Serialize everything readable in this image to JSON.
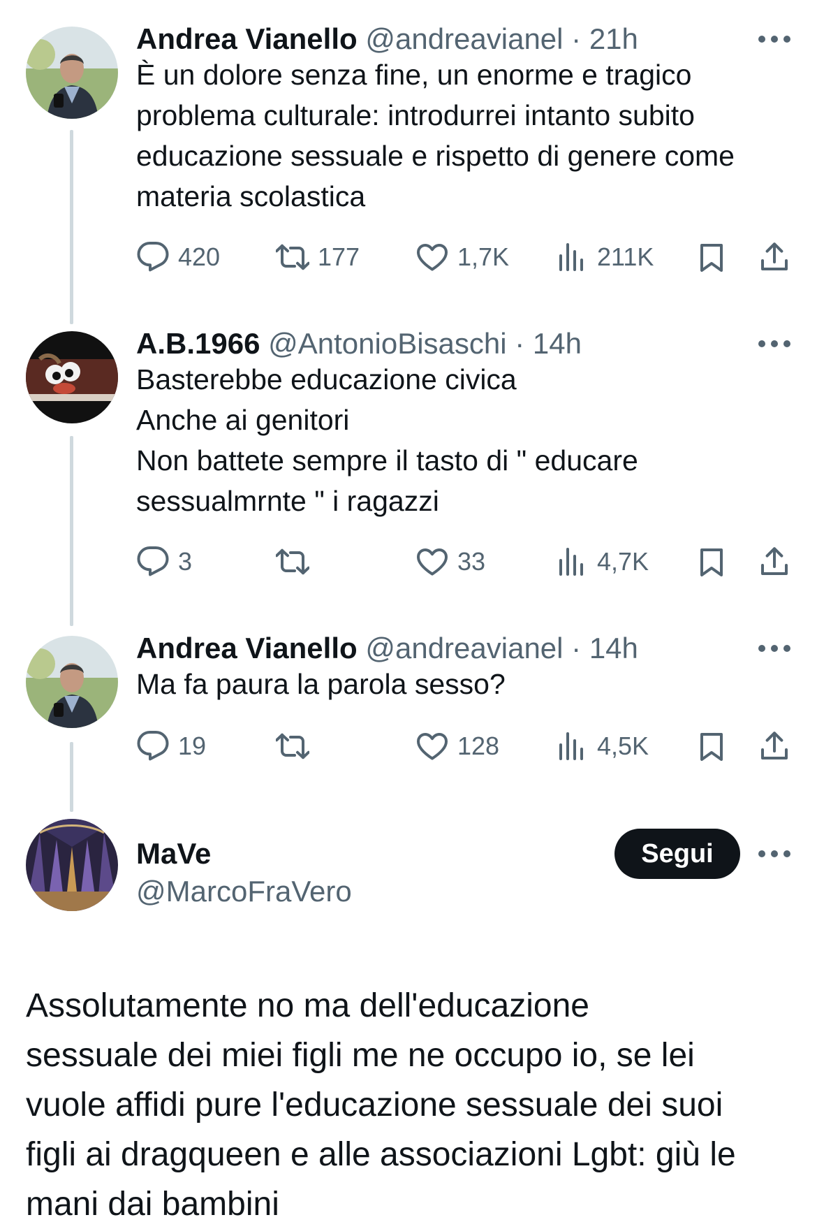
{
  "tweets": [
    {
      "name": "Andrea Vianello",
      "handle": "@andreavianel",
      "time": "21h",
      "text": "È un dolore senza fine, un enorme e tragico\nproblema culturale: introdurrei intanto subito\neducazione sessuale e rispetto di genere come\nmateria scolastica",
      "replies": "420",
      "reposts": "177",
      "likes": "1,7K",
      "views": "211K"
    },
    {
      "name": "A.B.1966",
      "handle": "@AntonioBisaschi",
      "time": "14h",
      "text": "Basterebbe educazione civica\nAnche ai genitori\nNon battete sempre il tasto di \" educare\nsessualmrnte \" i ragazzi",
      "replies": "3",
      "reposts": "",
      "likes": "33",
      "views": "4,7K"
    },
    {
      "name": "Andrea Vianello",
      "handle": "@andreavianel",
      "time": "14h",
      "text": "Ma fa paura la parola sesso?",
      "replies": "19",
      "reposts": "",
      "likes": "128",
      "views": "4,5K"
    }
  ],
  "main_tweet": {
    "name": "MaVe",
    "handle": "@MarcoFraVero",
    "follow_label": "Segui",
    "text": "Assolutamente no ma dell'educazione\nsessuale dei miei figli me ne occupo io, se lei\nvuole affidi pure l'educazione sessuale dei suoi\nfigli ai dragqueen e alle associazioni Lgbt: giù le\nmani dai bambini"
  },
  "separator": " · ",
  "icons": [
    "reply-icon",
    "repost-icon",
    "like-icon",
    "views-icon",
    "bookmark-icon",
    "share-icon",
    "more-icon"
  ],
  "colors": {
    "text": "#0f1419",
    "secondary": "#536471",
    "thread_line": "#cfd9de",
    "button_bg": "#0f1419"
  }
}
